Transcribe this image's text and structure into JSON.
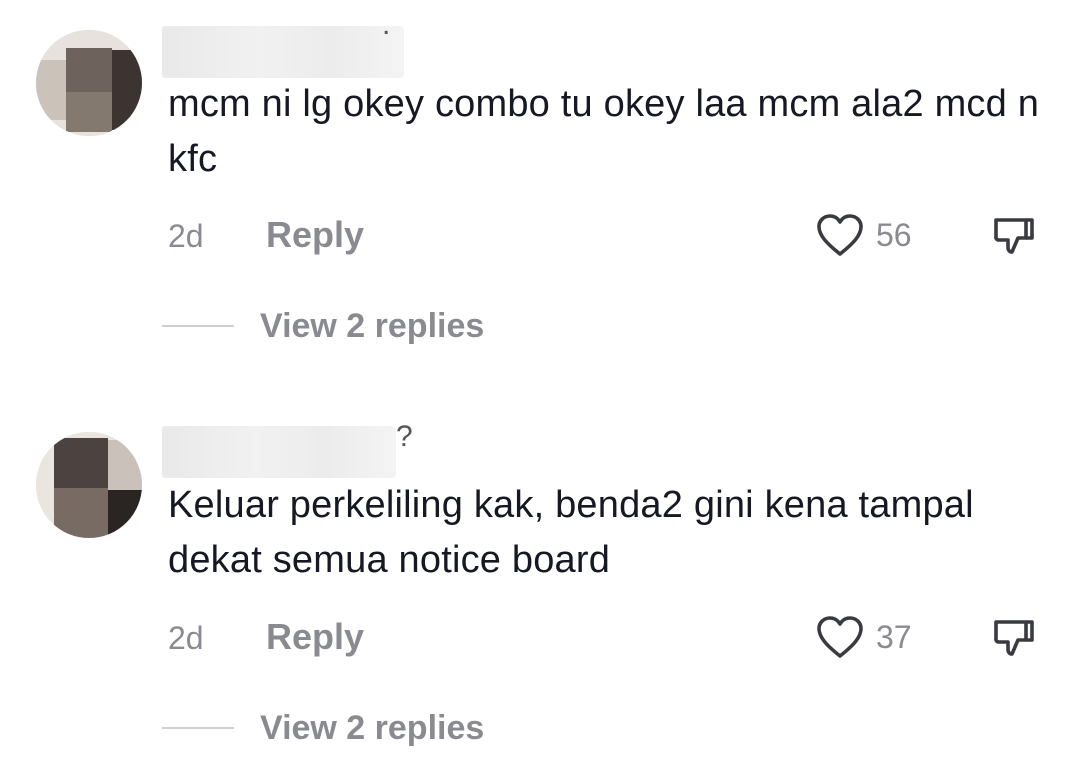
{
  "comments": [
    {
      "username_visible": ".",
      "text": "mcm ni lg okey combo tu okey laa mcm ala2 mcd n kfc",
      "time": "2d",
      "reply_label": "Reply",
      "likes": "56",
      "view_replies": "View 2 replies"
    },
    {
      "username_visible": "?",
      "text": "Keluar perkeliling kak, benda2 gini kena tampal dekat semua notice board",
      "time": "2d",
      "reply_label": "Reply",
      "likes": "37",
      "view_replies": "View 2 replies"
    }
  ],
  "colors": {
    "text": "#161823",
    "secondary": "#8a8b91",
    "divider": "#cfcfd2"
  },
  "icons": {
    "like": "heart-outline-icon",
    "dislike": "thumbs-down-outline-icon"
  }
}
